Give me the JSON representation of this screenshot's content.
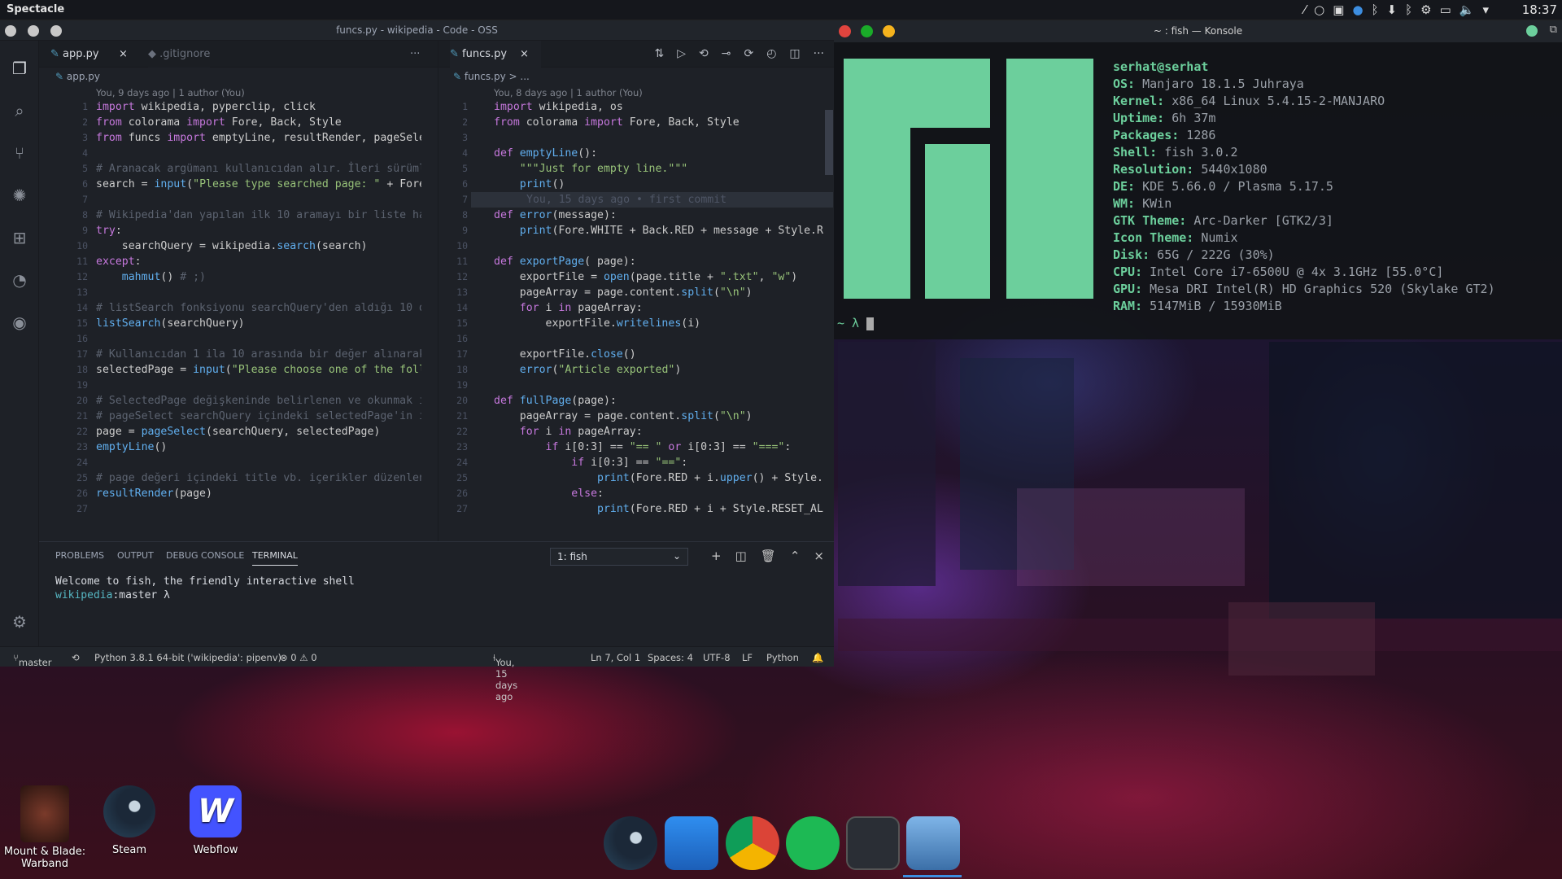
{
  "topbar": {
    "app": "Spectacle",
    "clock": "18:37"
  },
  "vscode": {
    "title": "funcs.py - wikipedia - Code - OSS",
    "left": {
      "tabs": [
        {
          "label": "app.py"
        },
        {
          "label": ".gitignore"
        }
      ],
      "breadcrumb": "app.py",
      "blame": "You, 9 days ago | 1 author (You)",
      "lines": [
        [
          {
            "t": "import ",
            "c": "kw"
          },
          {
            "t": "wikipedia, pyperclip, click",
            "c": "pl"
          }
        ],
        [
          {
            "t": "from ",
            "c": "kw"
          },
          {
            "t": "colorama ",
            "c": "pl"
          },
          {
            "t": "import ",
            "c": "kw"
          },
          {
            "t": "Fore, Back, Style",
            "c": "pl"
          }
        ],
        [
          {
            "t": "from ",
            "c": "kw"
          },
          {
            "t": "funcs ",
            "c": "pl"
          },
          {
            "t": "import ",
            "c": "kw"
          },
          {
            "t": "emptyLine, resultRender, pageSelect",
            "c": "pl"
          }
        ],
        [],
        [
          {
            "t": "# Aranacak argümanı kullanıcıdan alır. İleri sürümler",
            "c": "cm"
          }
        ],
        [
          {
            "t": "search = ",
            "c": "pl"
          },
          {
            "t": "input",
            "c": "fn"
          },
          {
            "t": "(",
            "c": "pl"
          },
          {
            "t": "\"Please type searched page: \"",
            "c": "str"
          },
          {
            "t": " + Fore.Y",
            "c": "pl"
          }
        ],
        [],
        [
          {
            "t": "# Wikipedia'dan yapılan ilk 10 aramayı bir liste hali",
            "c": "cm"
          }
        ],
        [
          {
            "t": "try",
            "c": "kw"
          },
          {
            "t": ":",
            "c": "pl"
          }
        ],
        [
          {
            "t": "    searchQuery = wikipedia.",
            "c": "pl"
          },
          {
            "t": "search",
            "c": "fn"
          },
          {
            "t": "(search)",
            "c": "pl"
          }
        ],
        [
          {
            "t": "except",
            "c": "kw"
          },
          {
            "t": ":",
            "c": "pl"
          }
        ],
        [
          {
            "t": "    ",
            "c": "pl"
          },
          {
            "t": "mahmut",
            "c": "fn"
          },
          {
            "t": "() ",
            "c": "pl"
          },
          {
            "t": "# ;)",
            "c": "cm"
          }
        ],
        [],
        [
          {
            "t": "# listSearch fonksiyonu searchQuery'den aldığı 10 d",
            "c": "cm"
          }
        ],
        [
          {
            "t": "listSearch",
            "c": "fn"
          },
          {
            "t": "(searchQuery)",
            "c": "pl"
          }
        ],
        [],
        [
          {
            "t": "# Kullanıcıdan 1 ila 10 arasında bir değer alınarak",
            "c": "cm"
          }
        ],
        [
          {
            "t": "selectedPage = ",
            "c": "pl"
          },
          {
            "t": "input",
            "c": "fn"
          },
          {
            "t": "(",
            "c": "pl"
          },
          {
            "t": "\"Please choose one of the follo",
            "c": "str"
          }
        ],
        [],
        [
          {
            "t": "# SelectedPage değişkeninde belirlenen ve okunmak ist",
            "c": "cm"
          }
        ],
        [
          {
            "t": "# pageSelect searchQuery içindeki selectedPage'in in",
            "c": "cm"
          }
        ],
        [
          {
            "t": "page = ",
            "c": "pl"
          },
          {
            "t": "pageSelect",
            "c": "fn"
          },
          {
            "t": "(searchQuery, selectedPage)",
            "c": "pl"
          }
        ],
        [
          {
            "t": "emptyLine",
            "c": "fn"
          },
          {
            "t": "()",
            "c": "pl"
          }
        ],
        [],
        [
          {
            "t": "# page değeri içindeki title vb. içerikler düzenlener",
            "c": "cm"
          }
        ],
        [
          {
            "t": "resultRender",
            "c": "fn"
          },
          {
            "t": "(page)",
            "c": "pl"
          }
        ],
        []
      ]
    },
    "right": {
      "tab": "funcs.py",
      "breadcrumb": "funcs.py > ...",
      "blame": "You, 8 days ago | 1 author (You)",
      "inline_blame": "You, 15 days ago • first commit",
      "lines": [
        [
          {
            "t": "import ",
            "c": "kw"
          },
          {
            "t": "wikipedia, os",
            "c": "pl"
          }
        ],
        [
          {
            "t": "from ",
            "c": "kw"
          },
          {
            "t": "colorama ",
            "c": "pl"
          },
          {
            "t": "import ",
            "c": "kw"
          },
          {
            "t": "Fore, Back, Style",
            "c": "pl"
          }
        ],
        [],
        [
          {
            "t": "def ",
            "c": "kw"
          },
          {
            "t": "emptyLine",
            "c": "fn"
          },
          {
            "t": "():",
            "c": "pl"
          }
        ],
        [
          {
            "t": "    ",
            "c": "pl"
          },
          {
            "t": "\"\"\"Just for empty line.\"\"\"",
            "c": "str"
          }
        ],
        [
          {
            "t": "    ",
            "c": "pl"
          },
          {
            "t": "print",
            "c": "fn"
          },
          {
            "t": "()",
            "c": "pl"
          }
        ],
        [],
        [
          {
            "t": "def ",
            "c": "kw"
          },
          {
            "t": "error",
            "c": "fn"
          },
          {
            "t": "(message):",
            "c": "pl"
          }
        ],
        [
          {
            "t": "    ",
            "c": "pl"
          },
          {
            "t": "print",
            "c": "fn"
          },
          {
            "t": "(Fore.WHITE + Back.RED + message + Style.RES",
            "c": "pl"
          }
        ],
        [],
        [
          {
            "t": "def ",
            "c": "kw"
          },
          {
            "t": "exportPage",
            "c": "fn"
          },
          {
            "t": "( page):",
            "c": "pl"
          }
        ],
        [
          {
            "t": "    exportFile = ",
            "c": "pl"
          },
          {
            "t": "open",
            "c": "fn"
          },
          {
            "t": "(page.title + ",
            "c": "pl"
          },
          {
            "t": "\".txt\"",
            "c": "str"
          },
          {
            "t": ", ",
            "c": "pl"
          },
          {
            "t": "\"w\"",
            "c": "str"
          },
          {
            "t": ")",
            "c": "pl"
          }
        ],
        [
          {
            "t": "    pageArray = page.content.",
            "c": "pl"
          },
          {
            "t": "split",
            "c": "fn"
          },
          {
            "t": "(",
            "c": "pl"
          },
          {
            "t": "\"\\n\"",
            "c": "str"
          },
          {
            "t": ")",
            "c": "pl"
          }
        ],
        [
          {
            "t": "    ",
            "c": "pl"
          },
          {
            "t": "for ",
            "c": "kw"
          },
          {
            "t": "i ",
            "c": "pl"
          },
          {
            "t": "in ",
            "c": "kw"
          },
          {
            "t": "pageArray:",
            "c": "pl"
          }
        ],
        [
          {
            "t": "        exportFile.",
            "c": "pl"
          },
          {
            "t": "writelines",
            "c": "fn"
          },
          {
            "t": "(i)",
            "c": "pl"
          }
        ],
        [],
        [
          {
            "t": "    exportFile.",
            "c": "pl"
          },
          {
            "t": "close",
            "c": "fn"
          },
          {
            "t": "()",
            "c": "pl"
          }
        ],
        [
          {
            "t": "    ",
            "c": "pl"
          },
          {
            "t": "error",
            "c": "fn"
          },
          {
            "t": "(",
            "c": "pl"
          },
          {
            "t": "\"Article exported\"",
            "c": "str"
          },
          {
            "t": ")",
            "c": "pl"
          }
        ],
        [],
        [
          {
            "t": "def ",
            "c": "kw"
          },
          {
            "t": "fullPage",
            "c": "fn"
          },
          {
            "t": "(page):",
            "c": "pl"
          }
        ],
        [
          {
            "t": "    pageArray = page.content.",
            "c": "pl"
          },
          {
            "t": "split",
            "c": "fn"
          },
          {
            "t": "(",
            "c": "pl"
          },
          {
            "t": "\"\\n\"",
            "c": "str"
          },
          {
            "t": ")",
            "c": "pl"
          }
        ],
        [
          {
            "t": "    ",
            "c": "pl"
          },
          {
            "t": "for ",
            "c": "kw"
          },
          {
            "t": "i ",
            "c": "pl"
          },
          {
            "t": "in ",
            "c": "kw"
          },
          {
            "t": "pageArray:",
            "c": "pl"
          }
        ],
        [
          {
            "t": "        ",
            "c": "pl"
          },
          {
            "t": "if ",
            "c": "kw"
          },
          {
            "t": "i[0:3] == ",
            "c": "pl"
          },
          {
            "t": "\"== \"",
            "c": "str"
          },
          {
            "t": " or ",
            "c": "kw"
          },
          {
            "t": "i[0:3] == ",
            "c": "pl"
          },
          {
            "t": "\"===\"",
            "c": "str"
          },
          {
            "t": ":",
            "c": "pl"
          }
        ],
        [
          {
            "t": "            ",
            "c": "pl"
          },
          {
            "t": "if ",
            "c": "kw"
          },
          {
            "t": "i[0:3] == ",
            "c": "pl"
          },
          {
            "t": "\"==\"",
            "c": "str"
          },
          {
            "t": ":",
            "c": "pl"
          }
        ],
        [
          {
            "t": "                ",
            "c": "pl"
          },
          {
            "t": "print",
            "c": "fn"
          },
          {
            "t": "(Fore.RED + i.",
            "c": "pl"
          },
          {
            "t": "upper",
            "c": "fn"
          },
          {
            "t": "() + Style.RE",
            "c": "pl"
          }
        ],
        [
          {
            "t": "            ",
            "c": "pl"
          },
          {
            "t": "else",
            "c": "kw"
          },
          {
            "t": ":",
            "c": "pl"
          }
        ],
        [
          {
            "t": "                ",
            "c": "pl"
          },
          {
            "t": "print",
            "c": "fn"
          },
          {
            "t": "(Fore.RED + i + Style.RESET_ALL",
            "c": "pl"
          }
        ]
      ]
    },
    "panel": {
      "tabs": [
        "PROBLEMS",
        "OUTPUT",
        "DEBUG CONSOLE",
        "TERMINAL"
      ],
      "shell_select": "1: fish",
      "term_welcome": "Welcome to fish, the friendly interactive shell",
      "term_prompt_path": "wikipedia",
      "term_prompt_branch": "master",
      "term_prompt_sym": "λ"
    },
    "status": {
      "branch": "master",
      "python": "Python 3.8.1 64-bit ('wikipedia': pipenv)",
      "problems": "⊗ 0 ⚠ 0",
      "blame": "You, 15 days ago",
      "position": "Ln 7, Col 1",
      "spaces": "Spaces: 4",
      "encoding": "UTF-8",
      "eol": "LF",
      "language": "Python"
    }
  },
  "konsole": {
    "title": "~ : fish — Konsole",
    "user": "serhat@serhat",
    "info": [
      {
        "k": "OS:",
        "v": "Manjaro 18.1.5 Juhraya"
      },
      {
        "k": "Kernel:",
        "v": "x86_64 Linux 5.4.15-2-MANJARO"
      },
      {
        "k": "Uptime:",
        "v": "6h 37m"
      },
      {
        "k": "Packages:",
        "v": "1286"
      },
      {
        "k": "Shell:",
        "v": "fish 3.0.2"
      },
      {
        "k": "Resolution:",
        "v": "5440x1080"
      },
      {
        "k": "DE:",
        "v": "KDE 5.66.0 / Plasma 5.17.5"
      },
      {
        "k": "WM:",
        "v": "KWin"
      },
      {
        "k": "GTK Theme:",
        "v": "Arc-Darker [GTK2/3]"
      },
      {
        "k": "Icon Theme:",
        "v": "Numix"
      },
      {
        "k": "Disk:",
        "v": "65G / 222G (30%)"
      },
      {
        "k": "CPU:",
        "v": "Intel Core i7-6500U @ 4x 3.1GHz [55.0°C]"
      },
      {
        "k": "GPU:",
        "v": "Mesa DRI Intel(R) HD Graphics 520 (Skylake GT2)"
      },
      {
        "k": "RAM:",
        "v": "5147MiB / 15930MiB"
      }
    ],
    "prompt": "~ λ"
  },
  "desktop": {
    "icons": [
      {
        "label": "Mount & Blade:\nWarband"
      },
      {
        "label": "Steam"
      },
      {
        "label": "Webflow"
      }
    ]
  },
  "colors": {
    "manjaro_green": "#6ccf9c",
    "accent": "#61afef"
  }
}
